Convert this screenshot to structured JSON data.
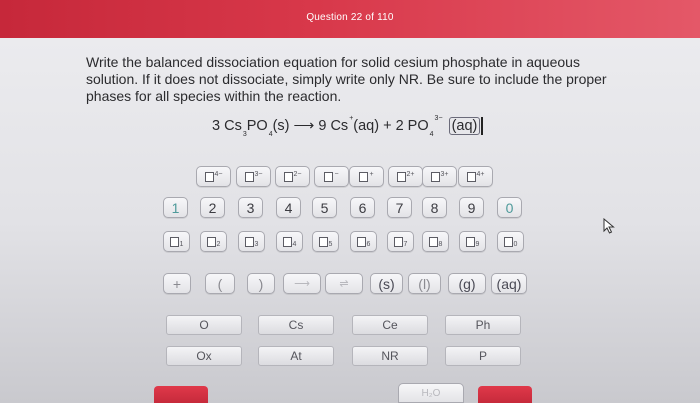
{
  "header": {
    "title": "Question 22 of 110"
  },
  "prompt": "Write the balanced dissociation equation for solid cesium phosphate in aqueous solution. If it does not dissociate, simply write only NR. Be sure to include the proper phases for all species within the reaction.",
  "equation": {
    "prefix": "3 Cs",
    "sub3": "3",
    "po4": "PO",
    "sub4": "4",
    "phase_s": "(s) ",
    "arrow": "⟶",
    "cs": " 9 Cs",
    "plus_sup": "+",
    "phase_aq": "(aq) + 2 PO",
    "po4_sub": "4",
    "po4_charge": "3−",
    "selected": "(aq)"
  },
  "keypad": {
    "charges": [
      "4−",
      "3−",
      "2−",
      "−",
      "+",
      "2+",
      "3+",
      "4+"
    ],
    "digits": [
      "1",
      "2",
      "3",
      "4",
      "5",
      "6",
      "7",
      "8",
      "9",
      "0"
    ],
    "subscripts": [
      "1",
      "2",
      "3",
      "4",
      "5",
      "6",
      "7",
      "8",
      "9",
      "0"
    ],
    "row4": {
      "plus": "+",
      "lparen": "(",
      "rparen": ")",
      "arrow": "⟶",
      "equil": "⇌",
      "s": "(s)",
      "l": "(l)",
      "g": "(g)",
      "aq": "(aq)"
    },
    "elements_row1": [
      "O",
      "Cs",
      "Ce",
      "Ph"
    ],
    "elements_row2": [
      "Ox",
      "At",
      "NR",
      "P"
    ],
    "bottom": {
      "hint": "H₂O"
    }
  },
  "colors": {
    "header": "#d8384a",
    "accent_teal": "#4e9a9a"
  }
}
